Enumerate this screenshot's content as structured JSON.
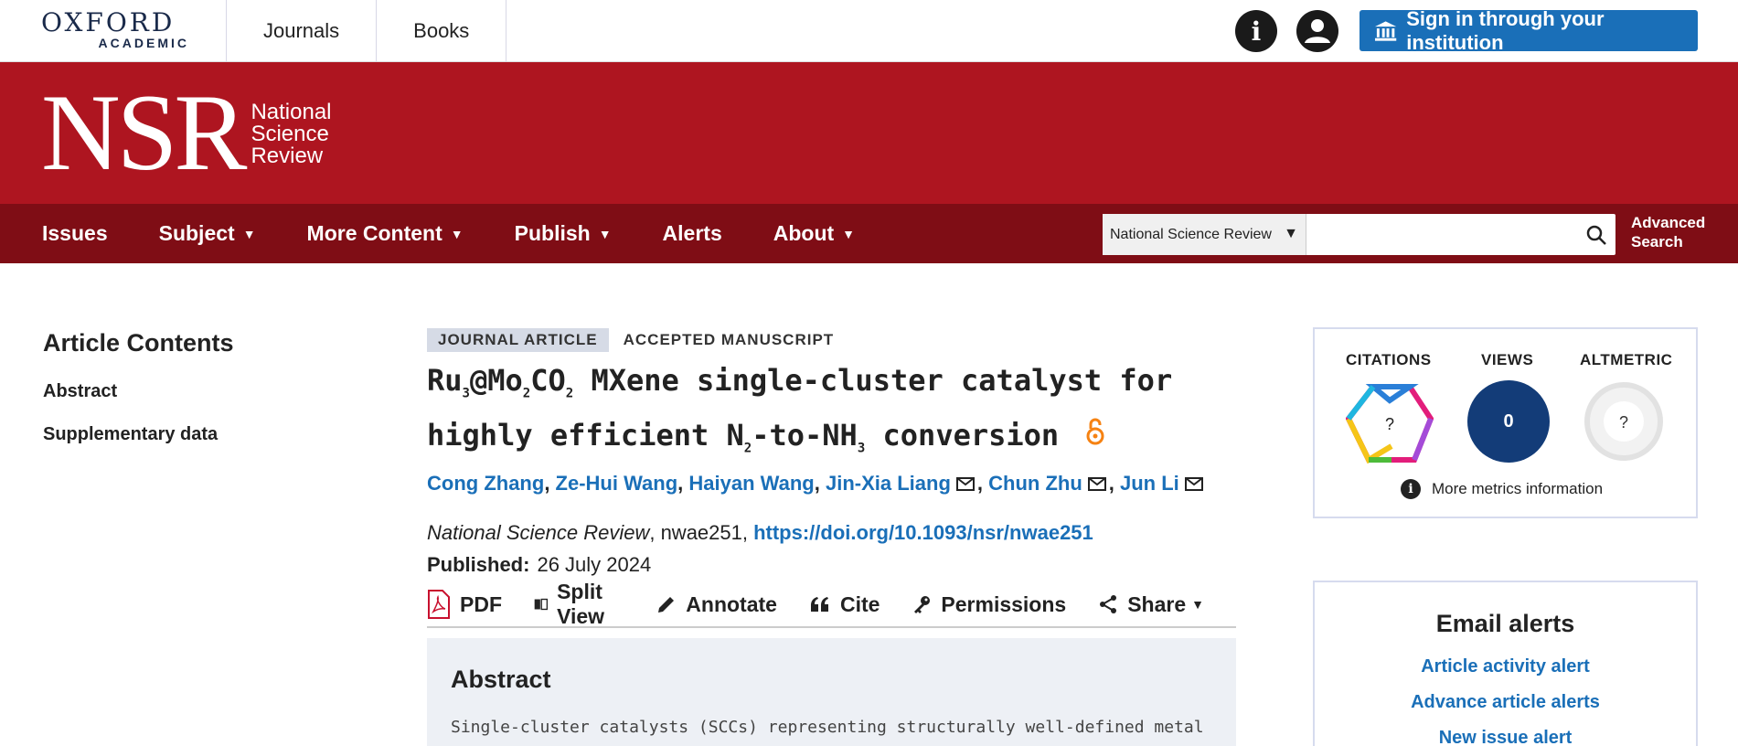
{
  "topbar": {
    "logo_top": "OXFORD",
    "logo_bottom": "ACADEMIC",
    "nav": [
      "Journals",
      "Books"
    ],
    "signin_label": "Sign in through your institution"
  },
  "banner": {
    "logo_letters": "NSR",
    "logo_line1": "National",
    "logo_line2": "Science",
    "logo_line3": "Review",
    "bg_color": "#ae1520"
  },
  "mainnav": {
    "items": [
      {
        "label": "Issues",
        "dropdown": false
      },
      {
        "label": "Subject",
        "dropdown": true
      },
      {
        "label": "More Content",
        "dropdown": true
      },
      {
        "label": "Publish",
        "dropdown": true
      },
      {
        "label": "Alerts",
        "dropdown": false
      },
      {
        "label": "About",
        "dropdown": true
      }
    ],
    "search_scope": "National Science Review",
    "search_value": "",
    "advanced_line1": "Advanced",
    "advanced_line2": "Search"
  },
  "sidebar": {
    "heading": "Article Contents",
    "items": [
      "Abstract",
      "Supplementary data"
    ]
  },
  "article": {
    "badge_type": "JOURNAL ARTICLE",
    "badge_status": "ACCEPTED MANUSCRIPT",
    "title_parts": {
      "t1": "Ru",
      "s1": "3",
      "t2": "@Mo",
      "s2": "2",
      "t3": "CO",
      "s3": "2",
      "t4": " MXene single-cluster catalyst for highly efficient N",
      "s4": "2",
      "t5": "-to-NH",
      "s5": "3",
      "t6": " conversion"
    },
    "authors": [
      {
        "name": "Cong Zhang",
        "email": false
      },
      {
        "name": "Ze-Hui Wang",
        "email": false
      },
      {
        "name": "Haiyan Wang",
        "email": false
      },
      {
        "name": "Jin-Xia Liang",
        "email": true
      },
      {
        "name": "Chun Zhu",
        "email": true
      },
      {
        "name": "Jun Li",
        "email": true
      }
    ],
    "journal": "National Science Review",
    "article_id": ", nwae251, ",
    "doi": "https://doi.org/10.1093/nsr/nwae251",
    "published_label": "Published:",
    "published_date": "26 July 2024"
  },
  "tools": {
    "pdf": "PDF",
    "split": "Split View",
    "annotate": "Annotate",
    "cite": "Cite",
    "permissions": "Permissions",
    "share": "Share"
  },
  "abstract": {
    "heading": "Abstract",
    "text": "Single-cluster catalysts (SCCs) representing structurally well-defined metal"
  },
  "metrics": {
    "citations_label": "CITATIONS",
    "views_label": "VIEWS",
    "altmetric_label": "ALTMETRIC",
    "citations_value": "?",
    "views_value": "0",
    "altmetric_value": "?",
    "more_label": "More metrics information"
  },
  "alerts": {
    "heading": "Email alerts",
    "links": [
      "Article activity alert",
      "Advance article alerts",
      "New issue alert"
    ]
  },
  "colors": {
    "accent_blue": "#1a6fb8",
    "nav_dark_red": "#7f0d15",
    "views_navy": "#133c78"
  }
}
